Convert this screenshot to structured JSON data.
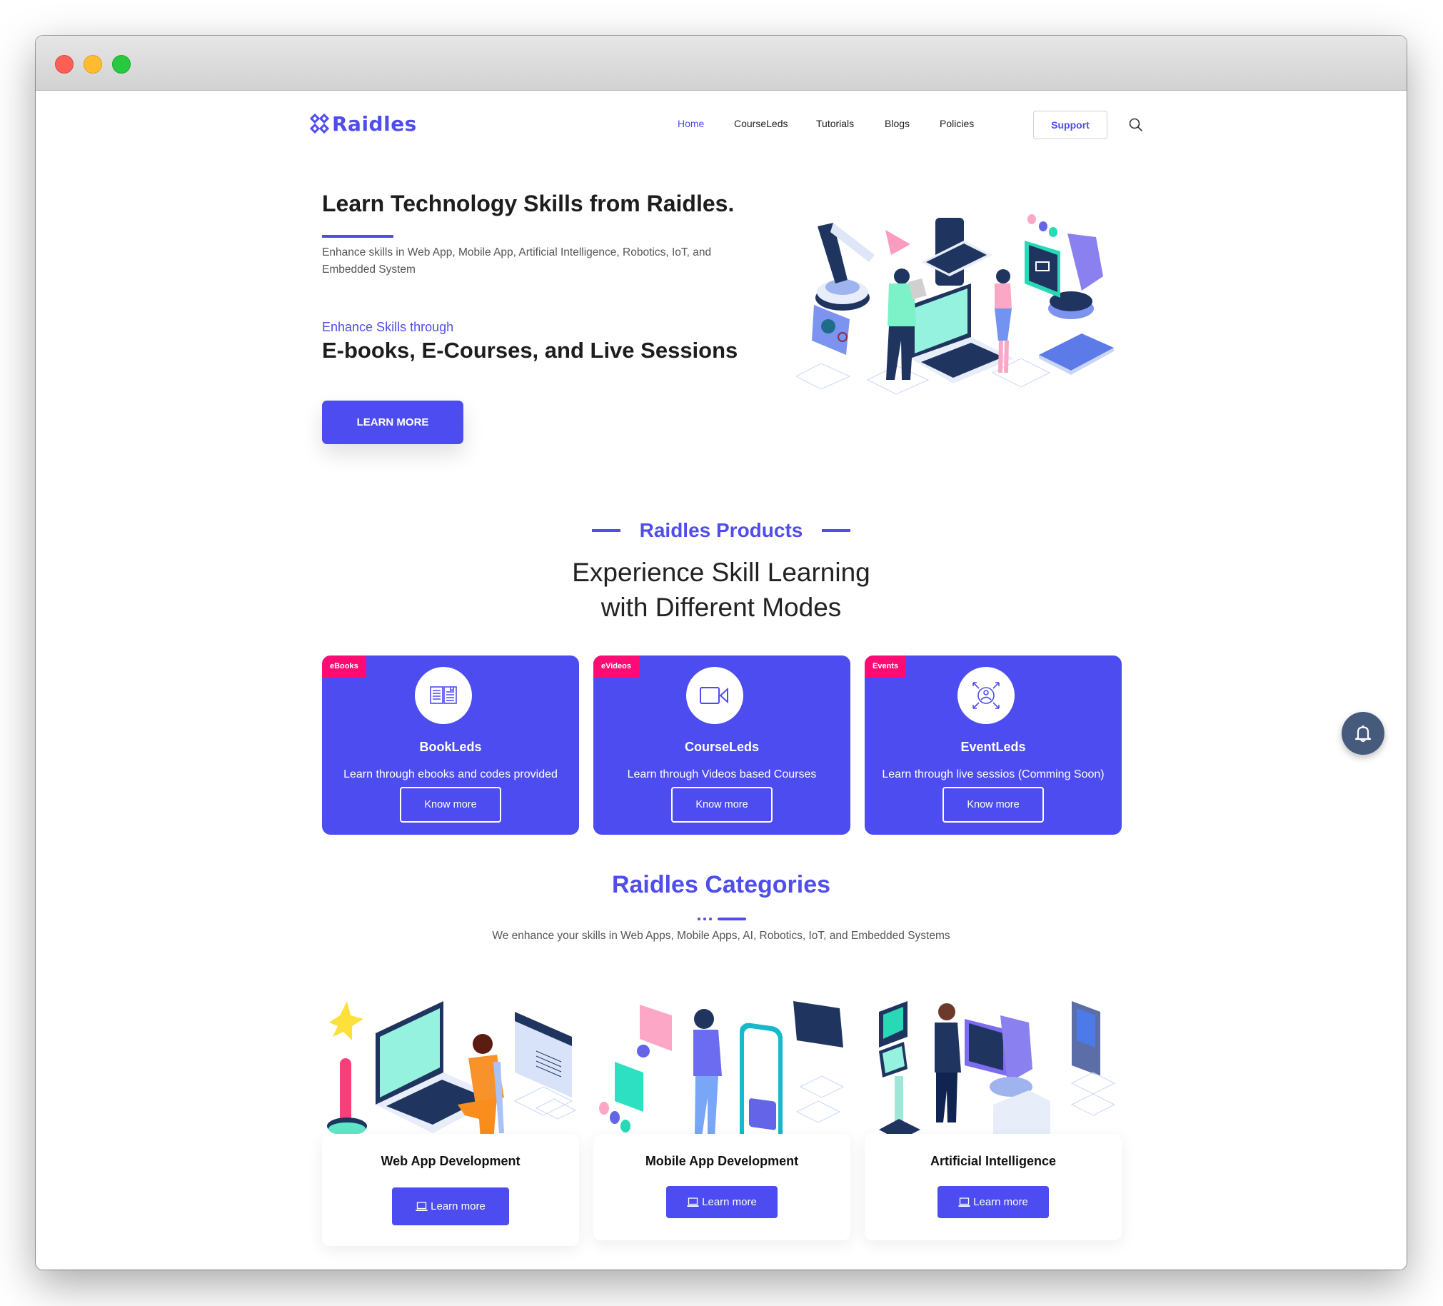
{
  "window": {
    "controls": [
      "close",
      "minimize",
      "maximize"
    ]
  },
  "header": {
    "logo_text": "Raidles",
    "nav": [
      {
        "label": "Home",
        "active": true
      },
      {
        "label": "CourseLeds",
        "active": false
      },
      {
        "label": "Tutorials",
        "active": false
      },
      {
        "label": "Blogs",
        "active": false
      },
      {
        "label": "Policies",
        "active": false
      }
    ],
    "support_label": "Support",
    "search_icon": "search-icon"
  },
  "hero": {
    "title": "Learn Technology Skills from Raidles.",
    "description": "Enhance skills in Web App, Mobile App, Artificial Intelligence, Robotics, IoT, and Embedded System",
    "kicker": "Enhance Skills through",
    "subtitle": "E-books, E-Courses, and Live Sessions",
    "cta_label": "LEARN MORE"
  },
  "products": {
    "kicker": "Raidles Products",
    "heading_line1": "Experience Skill Learning",
    "heading_line2": "with Different Modes",
    "items": [
      {
        "badge": "eBooks",
        "icon": "open-book-icon",
        "name": "BookLeds",
        "description": "Learn through ebooks and codes provided",
        "button": "Know more"
      },
      {
        "badge": "eVideos",
        "icon": "video-camera-icon",
        "name": "CourseLeds",
        "description": "Learn through Videos based Courses",
        "button": "Know more"
      },
      {
        "badge": "Events",
        "icon": "live-session-icon",
        "name": "EventLeds",
        "description": "Learn through live sessios (Comming Soon)",
        "button": "Know more"
      }
    ]
  },
  "categories": {
    "title": "Raidles Categories",
    "subtitle": "We enhance your skills in Web Apps, Mobile Apps, AI, Robotics, IoT, and Embedded Systems",
    "items": [
      {
        "name": "Web App Development",
        "button": "Learn more"
      },
      {
        "name": "Mobile App Development",
        "button": "Learn more"
      },
      {
        "name": "Artificial Intelligence",
        "button": "Learn more"
      }
    ]
  },
  "colors": {
    "brand": "#4c4cf0",
    "badge": "#fe0b74",
    "bell": "#465a7c",
    "text_dark": "#1d1d1f"
  },
  "notification_button_icon": "bell-icon"
}
